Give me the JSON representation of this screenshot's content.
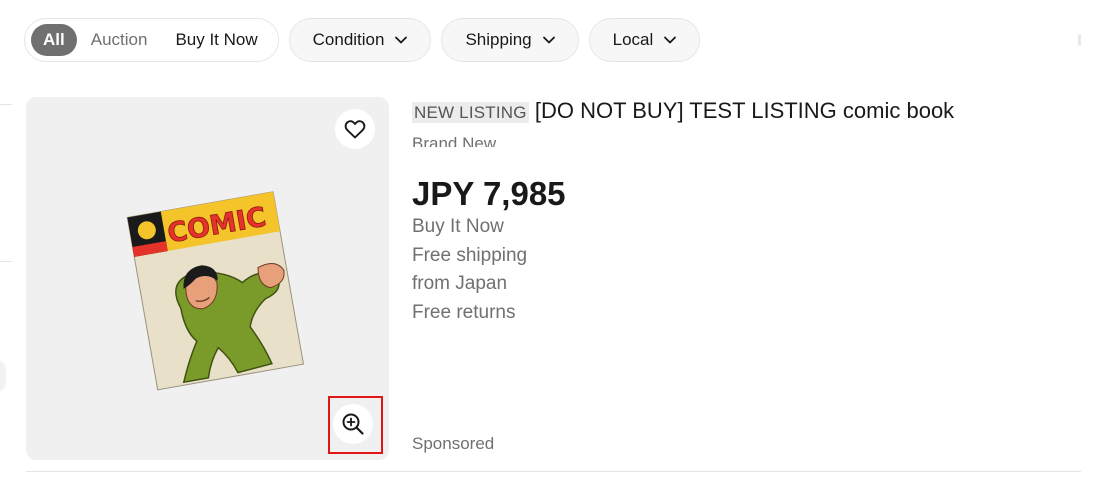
{
  "filters": {
    "buying_format": [
      "All",
      "Auction",
      "Buy It Now"
    ],
    "dropdowns": [
      "Condition",
      "Shipping",
      "Local"
    ]
  },
  "listing": {
    "badge": "NEW LISTING",
    "title": "[DO NOT BUY] TEST LISTING comic book",
    "condition": "Brand New",
    "price": "JPY 7,985",
    "format": "Buy It Now",
    "shipping": "Free shipping",
    "origin": "from Japan",
    "returns": "Free returns",
    "sponsored": "Sponsored",
    "image_text": "COMIC"
  },
  "icons": {
    "watch": "heart-icon",
    "zoom": "zoom-in-icon",
    "dropdown": "chevron-down-icon"
  },
  "colors": {
    "active_pill": "#707070",
    "highlight": "#e01616",
    "comic_yellow": "#f5c42a",
    "comic_red": "#e5322a"
  }
}
